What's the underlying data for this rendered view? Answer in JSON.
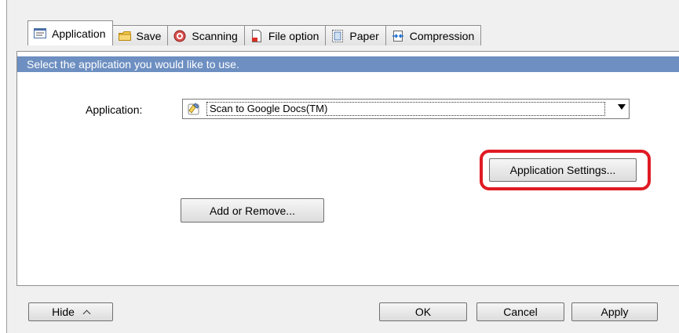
{
  "tabs": [
    {
      "label": "Application",
      "icon": "application-icon",
      "active": true
    },
    {
      "label": "Save",
      "icon": "folder-icon",
      "active": false
    },
    {
      "label": "Scanning",
      "icon": "scanning-icon",
      "active": false
    },
    {
      "label": "File option",
      "icon": "file-option-icon",
      "active": false
    },
    {
      "label": "Paper",
      "icon": "paper-icon",
      "active": false
    },
    {
      "label": "Compression",
      "icon": "compression-icon",
      "active": false
    }
  ],
  "panel": {
    "instruction": "Select the application you would like to use.",
    "application_label": "Application:",
    "application_value": "Scan to Google Docs(TM)",
    "application_settings_button": "Application Settings...",
    "add_remove_button": "Add or Remove..."
  },
  "footer": {
    "hide_button": "Hide",
    "ok_button": "OK",
    "cancel_button": "Cancel",
    "apply_button": "Apply"
  },
  "colors": {
    "banner": "#6d8fc1",
    "highlight": "#e01b24"
  }
}
